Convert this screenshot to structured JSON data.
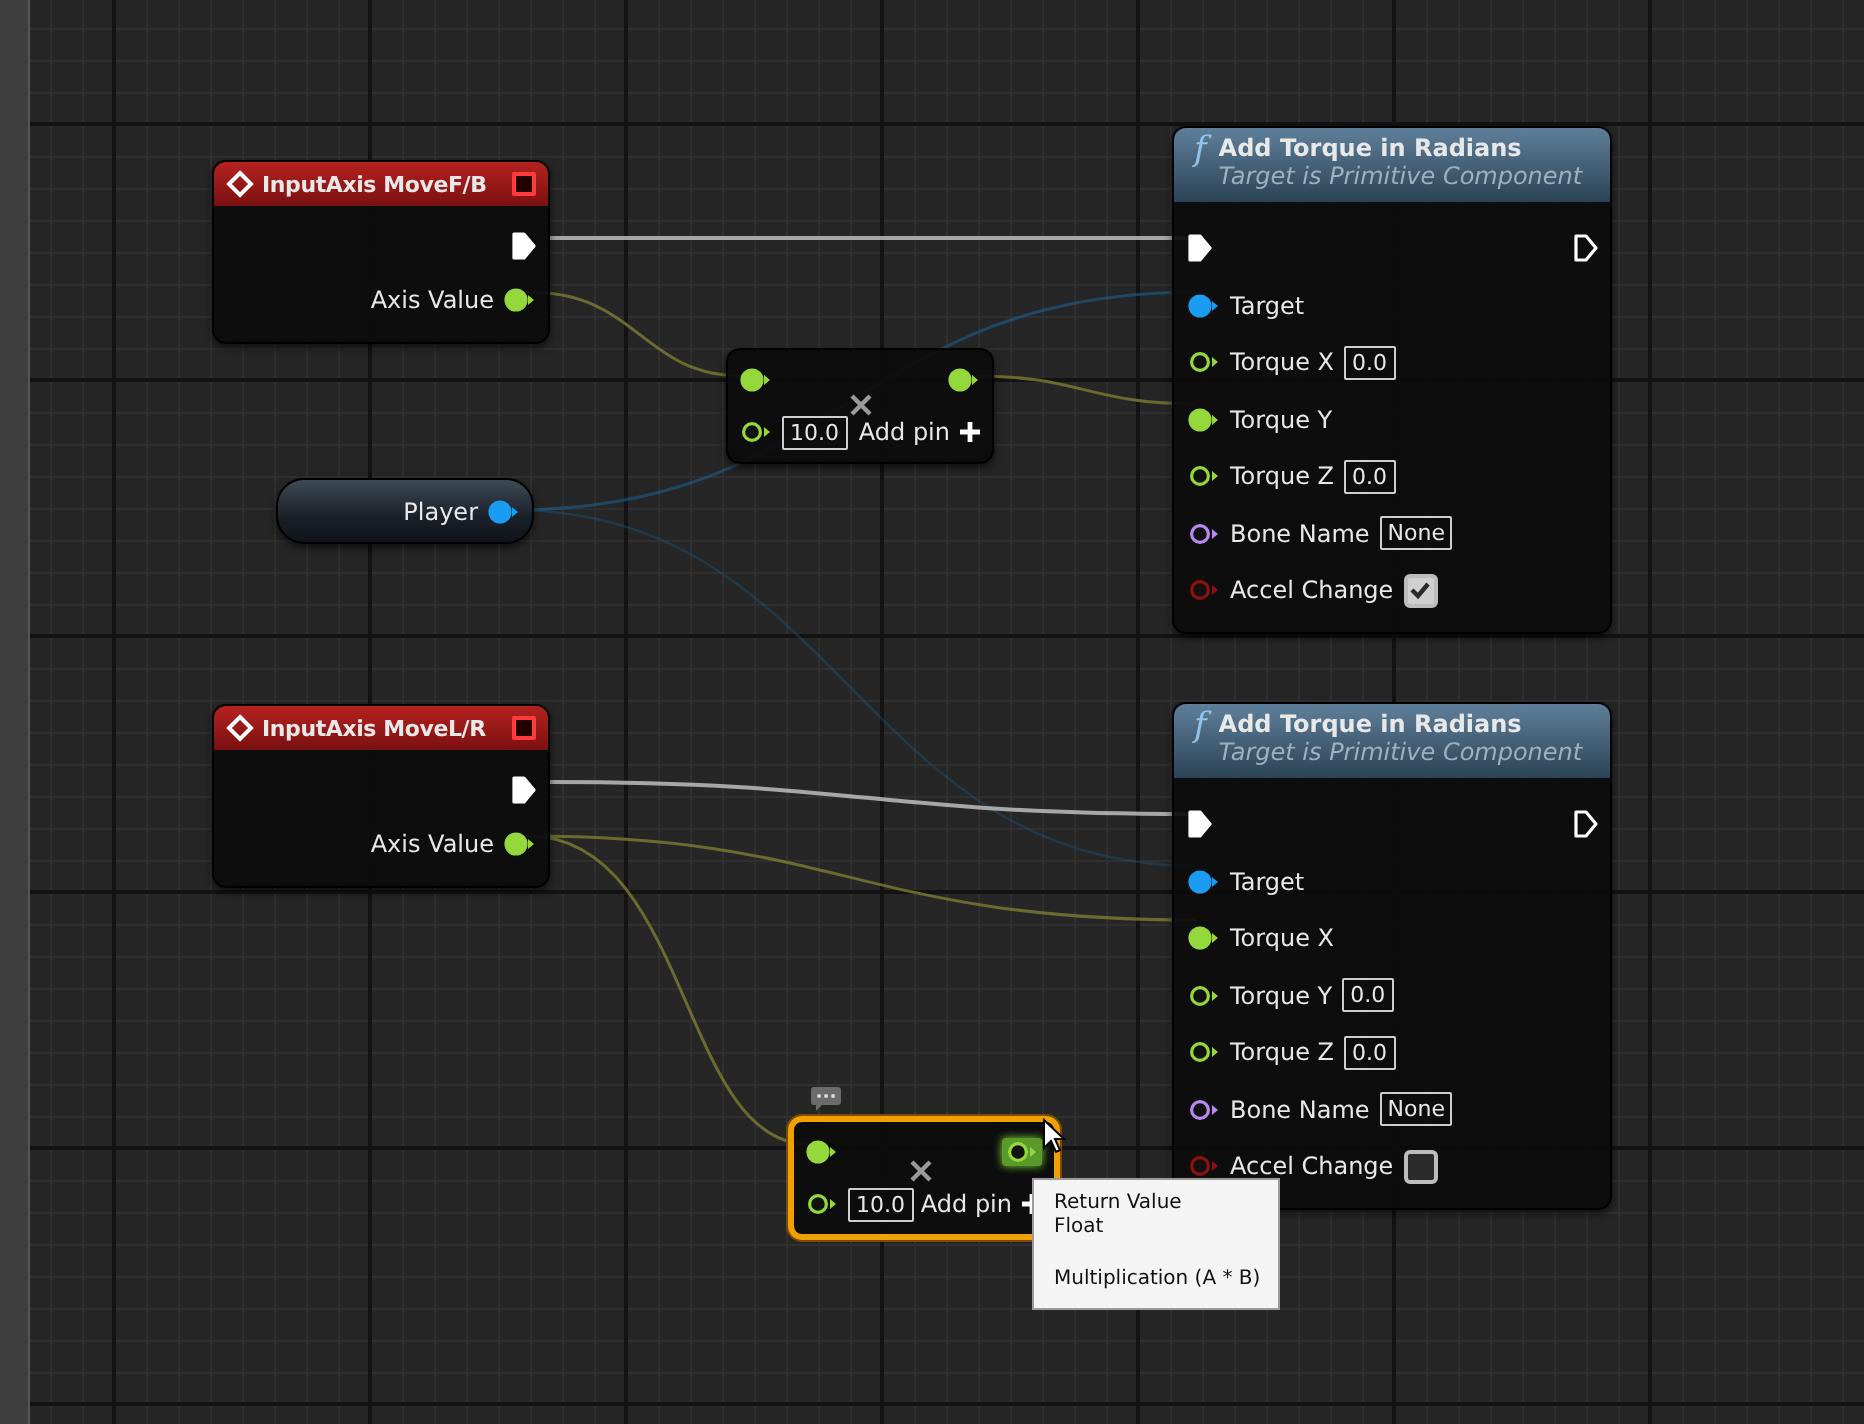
{
  "nodes": [
    {
      "kind": "event",
      "title": "InputAxis MoveF/B",
      "selected": false,
      "rows": [
        {
          "out": {
            "kind": "exec",
            "connected": true,
            "hovered": false
          }
        },
        {
          "out": {
            "kind": "float",
            "label": "Axis Value",
            "connected": true,
            "hovered": false
          }
        }
      ]
    },
    {
      "kind": "math",
      "selected": false,
      "comment_bubble": false,
      "add_pin": "Add pin",
      "rows": [
        {
          "in": {
            "kind": "float",
            "connected": true,
            "hovered": false
          },
          "out": {
            "kind": "float",
            "connected": true,
            "hovered": false
          }
        },
        {
          "in": {
            "kind": "float",
            "connected": false,
            "hovered": false,
            "value": "10.0"
          }
        }
      ]
    },
    {
      "kind": "variable",
      "selected": false,
      "rows": [
        {
          "out": {
            "kind": "object",
            "label": "Player",
            "connected": true,
            "hovered": false
          }
        }
      ]
    },
    {
      "kind": "function",
      "icon_glyph": "f",
      "title": "Add Torque in Radians",
      "subtitle": "Target is Primitive Component",
      "selected": false,
      "rows": [
        {
          "in": {
            "kind": "exec",
            "connected": true,
            "hovered": false
          },
          "out": {
            "kind": "exec",
            "connected": false,
            "hovered": false
          }
        },
        {
          "in": {
            "kind": "object",
            "label": "Target",
            "connected": true,
            "hovered": false
          }
        },
        {
          "in": {
            "kind": "float",
            "label": "Torque X",
            "connected": false,
            "hovered": false,
            "value": "0.0"
          }
        },
        {
          "in": {
            "kind": "float",
            "label": "Torque Y",
            "connected": true,
            "hovered": false
          }
        },
        {
          "in": {
            "kind": "float",
            "label": "Torque Z",
            "connected": false,
            "hovered": false,
            "value": "0.0"
          }
        },
        {
          "in": {
            "kind": "name",
            "label": "Bone Name",
            "connected": false,
            "hovered": false,
            "value": "None"
          }
        },
        {
          "in": {
            "kind": "bool",
            "label": "Accel Change",
            "connected": false,
            "hovered": false,
            "checked": true
          }
        }
      ]
    },
    {
      "kind": "event",
      "title": "InputAxis MoveL/R",
      "selected": false,
      "rows": [
        {
          "out": {
            "kind": "exec",
            "connected": true,
            "hovered": false
          }
        },
        {
          "out": {
            "kind": "float",
            "label": "Axis Value",
            "connected": true,
            "hovered": false
          }
        }
      ]
    },
    {
      "kind": "function",
      "icon_glyph": "f",
      "title": "Add Torque in Radians",
      "subtitle": "Target is Primitive Component",
      "selected": false,
      "rows": [
        {
          "in": {
            "kind": "exec",
            "connected": true,
            "hovered": false
          },
          "out": {
            "kind": "exec",
            "connected": false,
            "hovered": false
          }
        },
        {
          "in": {
            "kind": "object",
            "label": "Target",
            "connected": true,
            "hovered": false
          }
        },
        {
          "in": {
            "kind": "float",
            "label": "Torque X",
            "connected": true,
            "hovered": false
          }
        },
        {
          "in": {
            "kind": "float",
            "label": "Torque Y",
            "connected": false,
            "hovered": false,
            "value": "0.0"
          }
        },
        {
          "in": {
            "kind": "float",
            "label": "Torque Z",
            "connected": false,
            "hovered": false,
            "value": "0.0"
          }
        },
        {
          "in": {
            "kind": "name",
            "label": "Bone Name",
            "connected": false,
            "hovered": false,
            "value": "None"
          }
        },
        {
          "in": {
            "kind": "bool",
            "label": "Accel Change",
            "connected": false,
            "hovered": false,
            "checked": false
          }
        }
      ]
    },
    {
      "kind": "math",
      "selected": true,
      "comment_bubble": true,
      "add_pin": "Add pin",
      "rows": [
        {
          "in": {
            "kind": "float",
            "connected": true,
            "hovered": false
          },
          "out": {
            "kind": "float",
            "connected": false,
            "hovered": true
          }
        },
        {
          "in": {
            "kind": "float",
            "connected": false,
            "hovered": false,
            "value": "10.0"
          }
        }
      ]
    }
  ],
  "tooltip": {
    "title": "Return Value",
    "type": "Float",
    "description": "Multiplication (A * B)"
  }
}
